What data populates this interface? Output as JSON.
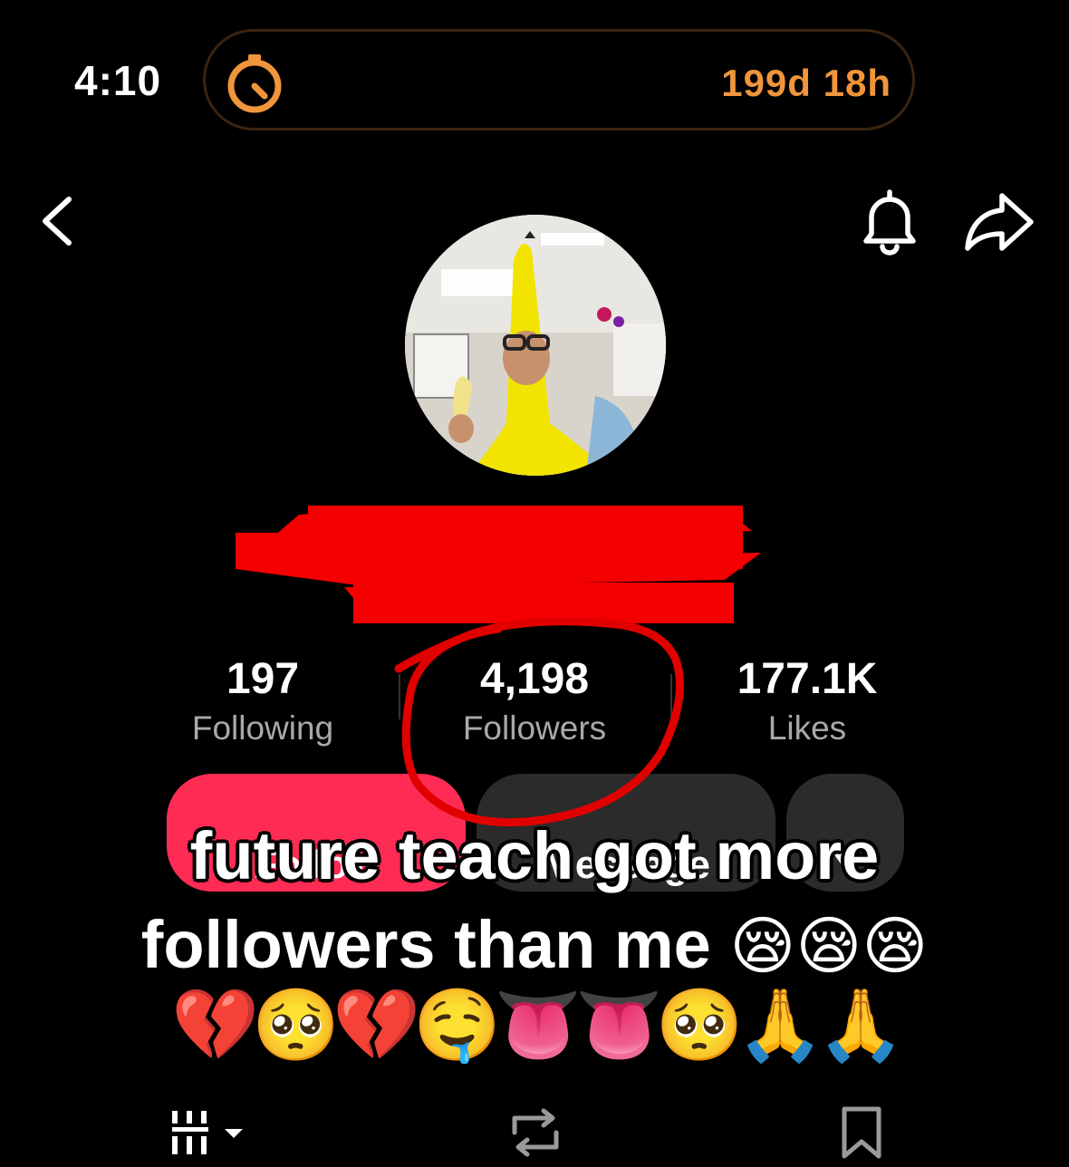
{
  "status_bar": {
    "time": "4:10",
    "timer": "199d 18h",
    "accent_color": "#f0953a"
  },
  "nav": {
    "back_icon": "chevron-left-icon",
    "bell_icon": "bell-icon",
    "share_icon": "share-icon"
  },
  "profile": {
    "avatar": "profile-photo",
    "name_redacted": true
  },
  "stats": {
    "following": {
      "value": "197",
      "label": "Following"
    },
    "followers": {
      "value": "4,198",
      "label": "Followers"
    },
    "likes": {
      "value": "177.1K",
      "label": "Likes"
    }
  },
  "buttons": {
    "follow": "Follow",
    "message": "Message",
    "more_icon": "caret-down-icon",
    "follow_color": "#fe2c55"
  },
  "caption": {
    "line1": "future teach got more",
    "line2_text": "followers than me",
    "line2_emojis": "😪😪😪",
    "line3_emojis": "💔🥺💔🤤👅👅🥺🙏🙏"
  },
  "tab_bar": {
    "grid_icon": "grid-icon",
    "repost_icon": "repost-icon",
    "bookmark_icon": "bookmark-icon"
  }
}
